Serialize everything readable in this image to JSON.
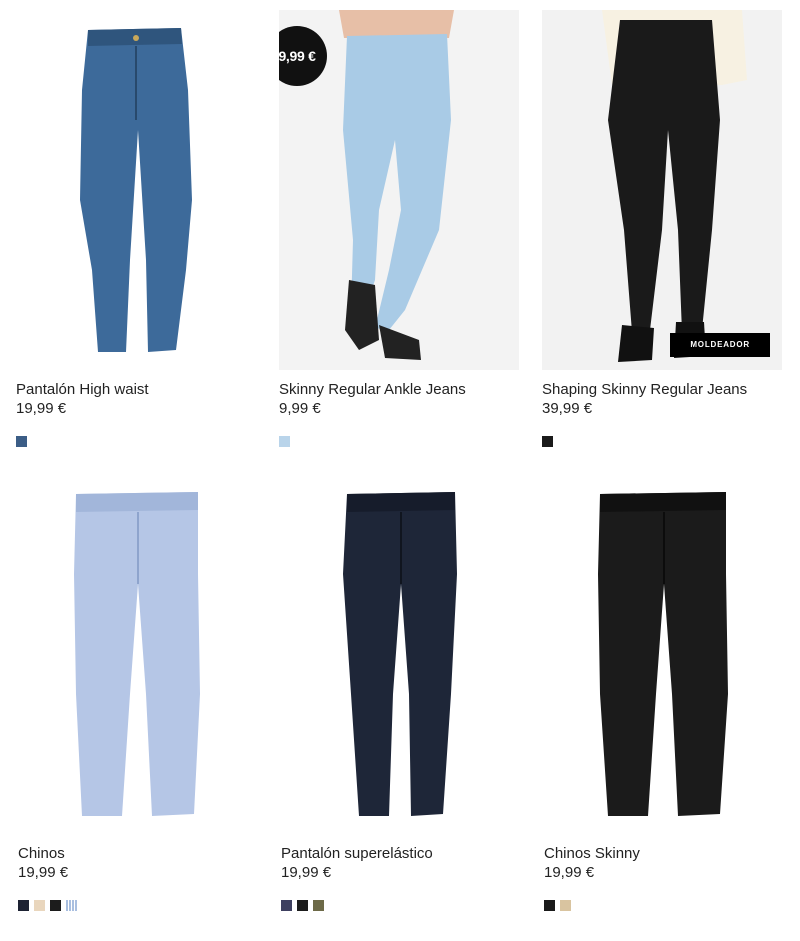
{
  "products": [
    {
      "name": "Pantalón High waist",
      "price": "19,99 €",
      "swatches": [
        "#3b5d86"
      ]
    },
    {
      "name": "Skinny Regular Ankle Jeans",
      "price": "9,99 €",
      "badge": "9,99 €",
      "swatches": [
        "#b9d4ea"
      ]
    },
    {
      "name": "Shaping Skinny Regular Jeans",
      "price": "39,99 €",
      "tag": "MOLDEADOR",
      "swatches": [
        "#1a1a1a"
      ]
    },
    {
      "name": "Chinos",
      "price": "19,99 €",
      "swatches": [
        "#1d2233",
        "#e9d6bd",
        "#1c1c1c",
        "#a9bfe0"
      ]
    },
    {
      "name": "Pantalón superelástico",
      "price": "19,99 €",
      "swatches": [
        "#3e4060",
        "#1c1c1c",
        "#6d6a48"
      ]
    },
    {
      "name": "Chinos Skinny",
      "price": "19,99 €",
      "swatches": [
        "#1a1a1a",
        "#d9c4a0"
      ]
    }
  ]
}
